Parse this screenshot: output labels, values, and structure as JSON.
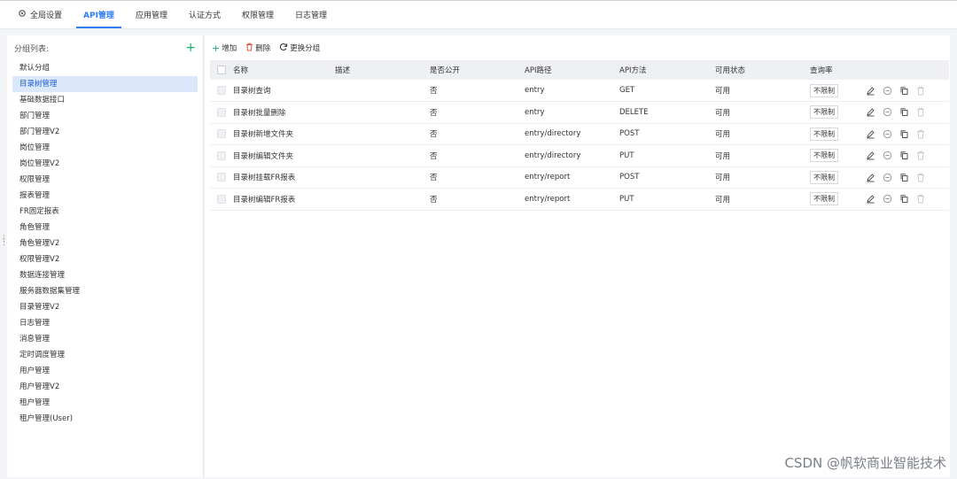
{
  "tabs": [
    {
      "label": "全局设置",
      "icon": "gear-icon",
      "active": false
    },
    {
      "label": "API管理",
      "active": true
    },
    {
      "label": "应用管理",
      "active": false
    },
    {
      "label": "认证方式",
      "active": false
    },
    {
      "label": "权限管理",
      "active": false
    },
    {
      "label": "日志管理",
      "active": false
    }
  ],
  "sidebar": {
    "title": "分组列表:",
    "add_icon": "plus-icon",
    "groups": [
      "默认分组",
      "目录树管理",
      "基础数据接口",
      "部门管理",
      "部门管理V2",
      "岗位管理",
      "岗位管理V2",
      "权限管理",
      "报表管理",
      "FR固定报表",
      "角色管理",
      "角色管理V2",
      "权限管理V2",
      "数据连接管理",
      "服务器数据集管理",
      "目录管理V2",
      "日志管理",
      "消息管理",
      "定时调度管理",
      "用户管理",
      "用户管理V2",
      "租户管理",
      "租户管理(User)"
    ],
    "selected_index": 1
  },
  "toolbar": {
    "add_label": "增加",
    "delete_label": "删除",
    "regroup_label": "更换分组"
  },
  "table": {
    "headers": {
      "name": "名称",
      "desc": "描述",
      "public": "是否公开",
      "path": "API路径",
      "method": "API方法",
      "status": "可用状态",
      "rate": "查询率"
    },
    "rows": [
      {
        "name": "目录树查询",
        "desc": "",
        "public": "否",
        "path": "entry",
        "method": "GET",
        "status": "可用",
        "rate": "不限制"
      },
      {
        "name": "目录树批量删除",
        "desc": "",
        "public": "否",
        "path": "entry",
        "method": "DELETE",
        "status": "可用",
        "rate": "不限制"
      },
      {
        "name": "目录树新增文件夹",
        "desc": "",
        "public": "否",
        "path": "entry/directory",
        "method": "POST",
        "status": "可用",
        "rate": "不限制"
      },
      {
        "name": "目录树编辑文件夹",
        "desc": "",
        "public": "否",
        "path": "entry/directory",
        "method": "PUT",
        "status": "可用",
        "rate": "不限制"
      },
      {
        "name": "目录树挂载FR报表",
        "desc": "",
        "public": "否",
        "path": "entry/report",
        "method": "POST",
        "status": "可用",
        "rate": "不限制"
      },
      {
        "name": "目录树编辑FR报表",
        "desc": "",
        "public": "否",
        "path": "entry/report",
        "method": "PUT",
        "status": "可用",
        "rate": "不限制"
      }
    ],
    "row_actions": [
      "edit-icon",
      "disable-icon",
      "copy-icon",
      "delete-icon"
    ]
  },
  "watermark": "CSDN @帆软商业智能技术"
}
